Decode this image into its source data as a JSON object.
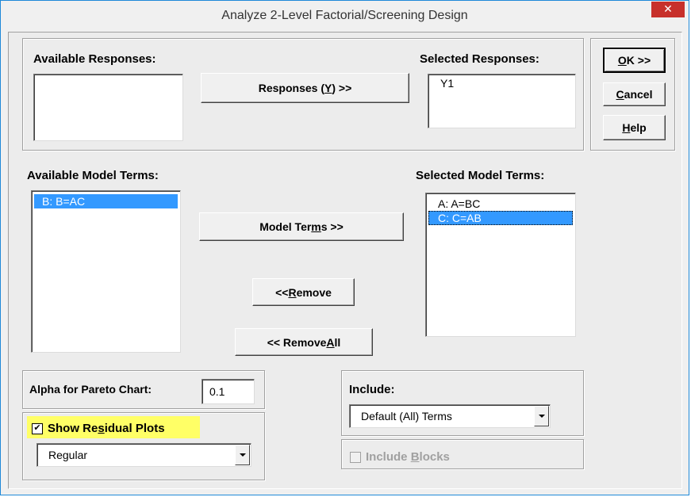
{
  "window": {
    "title": "Analyze 2-Level Factorial/Screening Design",
    "close_glyph": "✕"
  },
  "responses": {
    "available_label": "Available Responses:",
    "available_items": [],
    "selected_label": "Selected Responses:",
    "selected_items": [
      "Y1"
    ],
    "add_button": {
      "pre": "Responses (",
      "u": "Y",
      "post": ") >>"
    }
  },
  "actions": {
    "ok": {
      "u": "O",
      "rest": "K >>"
    },
    "cancel": {
      "u": "C",
      "rest": "ancel"
    },
    "help": {
      "u": "H",
      "rest": "elp"
    }
  },
  "model_terms": {
    "available_label": "Available Model Terms:",
    "available_items": [
      "B: B=AC"
    ],
    "selected_label": "Selected Model Terms:",
    "selected_items": [
      "A: A=BC",
      "C: C=AB"
    ],
    "add_button": {
      "pre": "Model Ter",
      "u": "m",
      "post": "s  >>"
    },
    "remove_button": {
      "pre": "<< ",
      "u": "R",
      "post": "emove"
    },
    "remove_all_button": {
      "pre": "<< Remove ",
      "u": "A",
      "post": "ll"
    }
  },
  "alpha": {
    "label": "Alpha for Pareto Chart:",
    "value": "0.1"
  },
  "residuals": {
    "checked": true,
    "check_glyph": "✔",
    "label_pre": "Show Re",
    "label_u": "s",
    "label_post": "idual Plots",
    "highlight_color": "#ffff66",
    "dropdown_value": "Regular"
  },
  "include": {
    "label": "Include:",
    "dropdown_value": "Default (All) Terms",
    "blocks_pre": "Include ",
    "blocks_u": "B",
    "blocks_post": "locks",
    "blocks_checked": false
  },
  "colors": {
    "selection": "#3399ff",
    "close_button": "#c7302b",
    "window_border": "#1f89d8"
  }
}
